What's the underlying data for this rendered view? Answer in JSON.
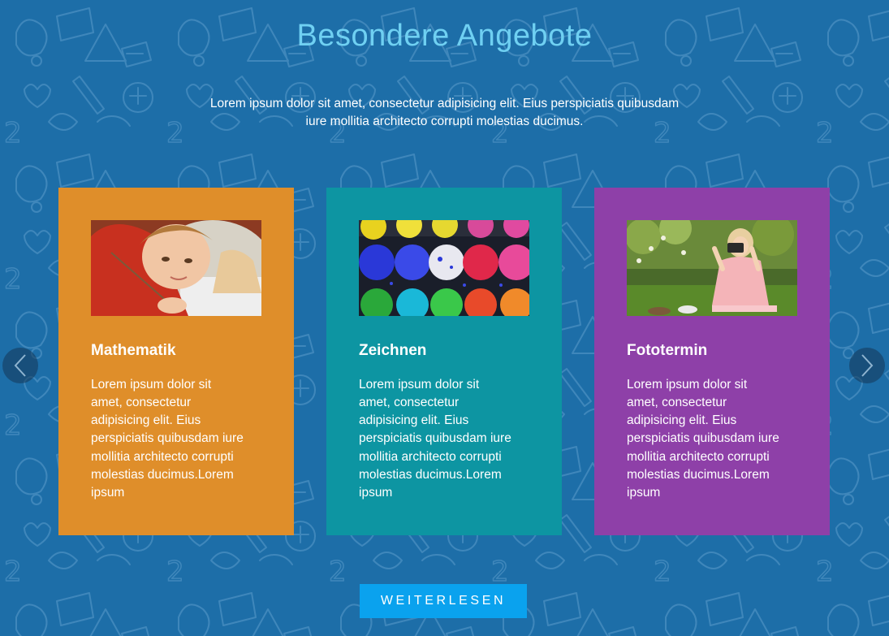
{
  "section": {
    "title": "Besondere Angebote",
    "intro": "Lorem ipsum dolor sit amet, consectetur adipisicing elit. Eius perspiciatis quibusdam iure mollitia architecto corrupti molestias ducimus."
  },
  "cards": [
    {
      "title": "Mathematik",
      "text": "Lorem ipsum dolor sit amet, consectetur adipisicing elit. Eius perspiciatis quibusdam iure mollitia architecto corrupti molestias ducimus.Lorem ipsum",
      "color": "#df8e2a"
    },
    {
      "title": "Zeichnen",
      "text": "Lorem ipsum dolor sit amet, consectetur adipisicing elit. Eius perspiciatis quibusdam iure mollitia architecto corrupti molestias ducimus.Lorem ipsum",
      "color": "#0d95a2"
    },
    {
      "title": "Fototermin",
      "text": "Lorem ipsum dolor sit amet, consectetur adipisicing elit. Eius perspiciatis quibusdam iure mollitia architecto corrupti molestias ducimus.Lorem ipsum",
      "color": "#8e40a8"
    }
  ],
  "carousel": {
    "prev_icon": "chevron-left-icon",
    "next_icon": "chevron-right-icon"
  },
  "cta": {
    "label": "WEITERLESEN"
  },
  "colors": {
    "background": "#1d6ea8",
    "title": "#6fd0f2",
    "button": "#0aa2ee"
  }
}
